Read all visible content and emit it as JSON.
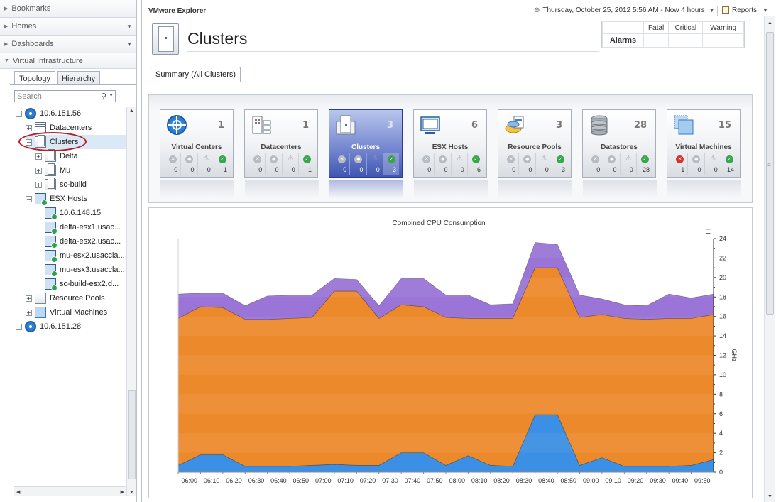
{
  "nav": {
    "sections": [
      {
        "label": "Bookmarks",
        "has_menu": false
      },
      {
        "label": "Homes",
        "has_menu": true
      },
      {
        "label": "Dashboards",
        "has_menu": true
      }
    ],
    "virtual_infrastructure": {
      "label": "Virtual Infrastructure",
      "tabs": [
        "Topology",
        "Hierarchy"
      ],
      "active_tab": "Topology",
      "search_placeholder": "Search",
      "tree": [
        {
          "label": "10.6.151.56",
          "icon": "vcenter-icon",
          "expander": "−"
        },
        {
          "label": "Datacenters",
          "icon": "datacenter-icon",
          "expander": "+"
        },
        {
          "label": "Clusters",
          "icon": "cluster-icon",
          "expander": "−",
          "selected": true
        },
        {
          "label": "Delta",
          "icon": "cluster-icon",
          "expander": "+"
        },
        {
          "label": "Mu",
          "icon": "cluster-icon",
          "expander": "+"
        },
        {
          "label": "sc-build",
          "icon": "cluster-icon",
          "expander": "+"
        },
        {
          "label": "ESX Hosts",
          "icon": "host-icon",
          "expander": "−"
        },
        {
          "label": "10.6.148.15",
          "icon": "host-icon"
        },
        {
          "label": "delta-esx1.usac...",
          "icon": "host-icon"
        },
        {
          "label": "delta-esx2.usac...",
          "icon": "host-icon"
        },
        {
          "label": "mu-esx2.usaccla...",
          "icon": "host-icon"
        },
        {
          "label": "mu-esx3.usaccla...",
          "icon": "host-icon"
        },
        {
          "label": "sc-build-esx2.d...",
          "icon": "host-icon"
        },
        {
          "label": "Resource Pools",
          "icon": "resource-pool-icon",
          "expander": "+"
        },
        {
          "label": "Virtual Machines",
          "icon": "vm-icon",
          "expander": "+"
        },
        {
          "label": "10.6.151.28",
          "icon": "vcenter-icon",
          "expander": "−"
        }
      ]
    }
  },
  "header": {
    "app_title": "VMware Explorer",
    "time_range": "Thursday, October 25, 2012 5:56 AM - Now 4 hours",
    "reports_label": "Reports",
    "page_title": "Clusters"
  },
  "alarms": {
    "label": "Alarms",
    "columns": [
      "Fatal",
      "Critical",
      "Warning"
    ],
    "values": [
      "",
      "",
      ""
    ]
  },
  "summary_tab": "Summary (All Clusters)",
  "cards": [
    {
      "name": "Virtual Centers",
      "count": "1",
      "icon": "vcenter-icon",
      "stats": [
        "0",
        "0",
        "0",
        "1"
      ],
      "fatal": false
    },
    {
      "name": "Datacenters",
      "count": "1",
      "icon": "datacenter-icon",
      "stats": [
        "0",
        "0",
        "0",
        "1"
      ],
      "fatal": false
    },
    {
      "name": "Clusters",
      "count": "3",
      "icon": "cluster-icon",
      "stats": [
        "0",
        "0",
        "0",
        "3"
      ],
      "fatal": false,
      "selected": true
    },
    {
      "name": "ESX Hosts",
      "count": "6",
      "icon": "host-icon",
      "stats": [
        "0",
        "0",
        "0",
        "6"
      ],
      "fatal": false
    },
    {
      "name": "Resource Pools",
      "count": "3",
      "icon": "resource-pool-icon",
      "stats": [
        "0",
        "0",
        "0",
        "3"
      ],
      "fatal": false
    },
    {
      "name": "Datastores",
      "count": "28",
      "icon": "datastore-icon",
      "stats": [
        "0",
        "0",
        "0",
        "28"
      ],
      "fatal": false
    },
    {
      "name": "Virtual Machines",
      "count": "15",
      "icon": "vm-icon",
      "stats": [
        "1",
        "0",
        "0",
        "14"
      ],
      "fatal": true
    }
  ],
  "colors": {
    "accent": "#4056b2",
    "series_purple": "#9a74d6",
    "series_orange": "#ec8a2b",
    "series_blue": "#3b8fe4",
    "ok": "#3aa64a",
    "fatal": "#d2352b"
  },
  "chart_data": {
    "type": "area",
    "title": "Combined CPU Consumption",
    "ylabel": "GHz",
    "ylim": [
      0,
      24
    ],
    "yticks": [
      0,
      2,
      4,
      6,
      8,
      10,
      12,
      14,
      16,
      18,
      20,
      22,
      24
    ],
    "stacked": true,
    "legend": "none",
    "x": [
      "06:00",
      "06:10",
      "06:20",
      "06:30",
      "06:40",
      "06:50",
      "07:00",
      "07:10",
      "07:20",
      "07:30",
      "07:40",
      "07:50",
      "08:00",
      "08:10",
      "08:20",
      "08:30",
      "08:40",
      "08:50",
      "09:00",
      "09:10",
      "09:20",
      "09:30",
      "09:40",
      "09:50"
    ],
    "x_pos": [
      0,
      1,
      2,
      3,
      4,
      5,
      6,
      7,
      8,
      9,
      10,
      11,
      12,
      13,
      14,
      15,
      16,
      17,
      18,
      19,
      20,
      21,
      22,
      23,
      24
    ],
    "series": [
      {
        "name": "",
        "color": "#3b8fe4",
        "values": [
          0.7,
          1.8,
          1.8,
          0.6,
          0.6,
          0.6,
          0.7,
          0.8,
          0.7,
          0.7,
          2.0,
          2.0,
          0.7,
          1.7,
          0.7,
          0.6,
          5.9,
          5.9,
          0.7,
          1.5,
          0.6,
          0.6,
          0.6,
          0.7,
          1.3
        ]
      },
      {
        "name": "",
        "color": "#ec8a2b",
        "values": [
          15.1,
          15.2,
          15.1,
          15.1,
          15.1,
          15.2,
          15.2,
          17.8,
          17.9,
          15.1,
          15.2,
          15.0,
          15.2,
          14.1,
          15.1,
          15.2,
          15.1,
          15.1,
          15.2,
          14.7,
          15.2,
          15.1,
          15.2,
          15.1,
          14.9
        ]
      },
      {
        "name": "",
        "color": "#9a74d6",
        "values": [
          2.5,
          1.4,
          1.5,
          1.4,
          2.4,
          2.4,
          2.3,
          1.3,
          1.2,
          1.3,
          2.7,
          2.9,
          2.3,
          2.4,
          1.4,
          1.5,
          2.6,
          2.4,
          2.3,
          1.6,
          1.4,
          1.4,
          2.5,
          2.1,
          2.1
        ]
      }
    ]
  }
}
